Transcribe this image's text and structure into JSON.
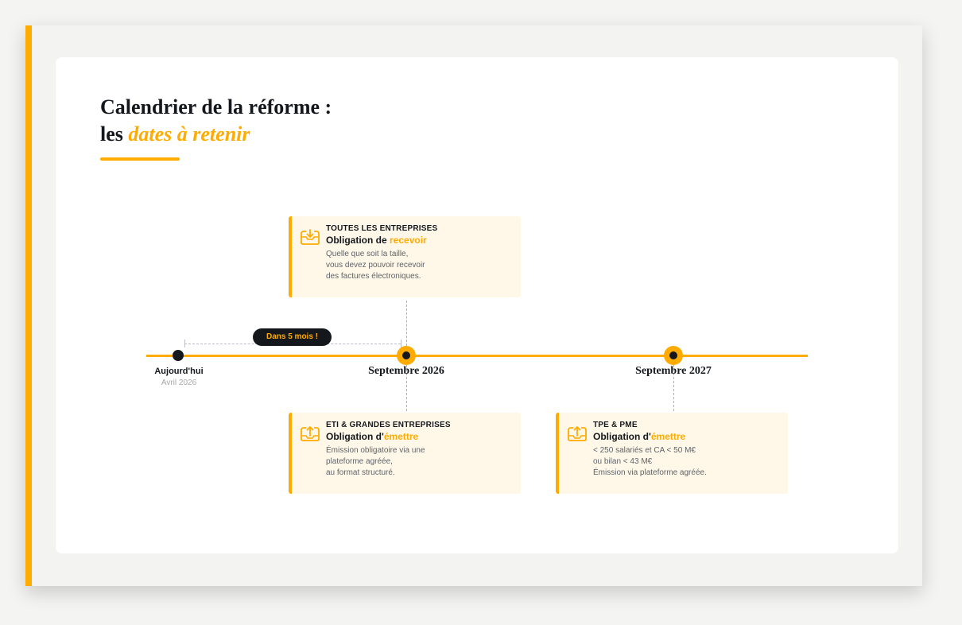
{
  "header": {
    "title_line1": "Calendrier de la réforme :",
    "title_line2_prefix": "les ",
    "title_line2_accent": "dates à retenir"
  },
  "colors": {
    "accent": "#ffab00",
    "dark": "#14181d",
    "card_background": "#fff8e9",
    "muted_text": "#5f6368"
  },
  "timeline": {
    "today": {
      "label": "Aujourd'hui",
      "sublabel": "Avril 2026"
    },
    "countdown_label": "Dans 5 mois !",
    "milestones": [
      {
        "label": "Septembre 2026"
      },
      {
        "label": "Septembre 2027"
      }
    ]
  },
  "events": [
    {
      "icon": "receive-invoice-icon",
      "kicker": "TOUTES LES ENTREPRISES",
      "heading_prefix": "Obligation de ",
      "heading_highlight": "recevoir",
      "description": [
        "Quelle que soit la taille,",
        "vous devez pouvoir recevoir",
        "des factures électroniques."
      ]
    },
    {
      "icon": "send-invoice-icon",
      "kicker": "ETI & GRANDES ENTREPRISES",
      "heading_prefix": "Obligation d'",
      "heading_highlight": "émettre",
      "description": [
        "Émission obligatoire via une",
        "plateforme agréée,",
        "au format structuré."
      ]
    },
    {
      "icon": "send-invoice-icon",
      "kicker": "TPE & PME",
      "heading_prefix": "Obligation d'",
      "heading_highlight": "émettre",
      "description": [
        "< 250 salariés et CA < 50 M€",
        "ou bilan < 43 M€",
        "Émission via plateforme agréée."
      ]
    }
  ]
}
